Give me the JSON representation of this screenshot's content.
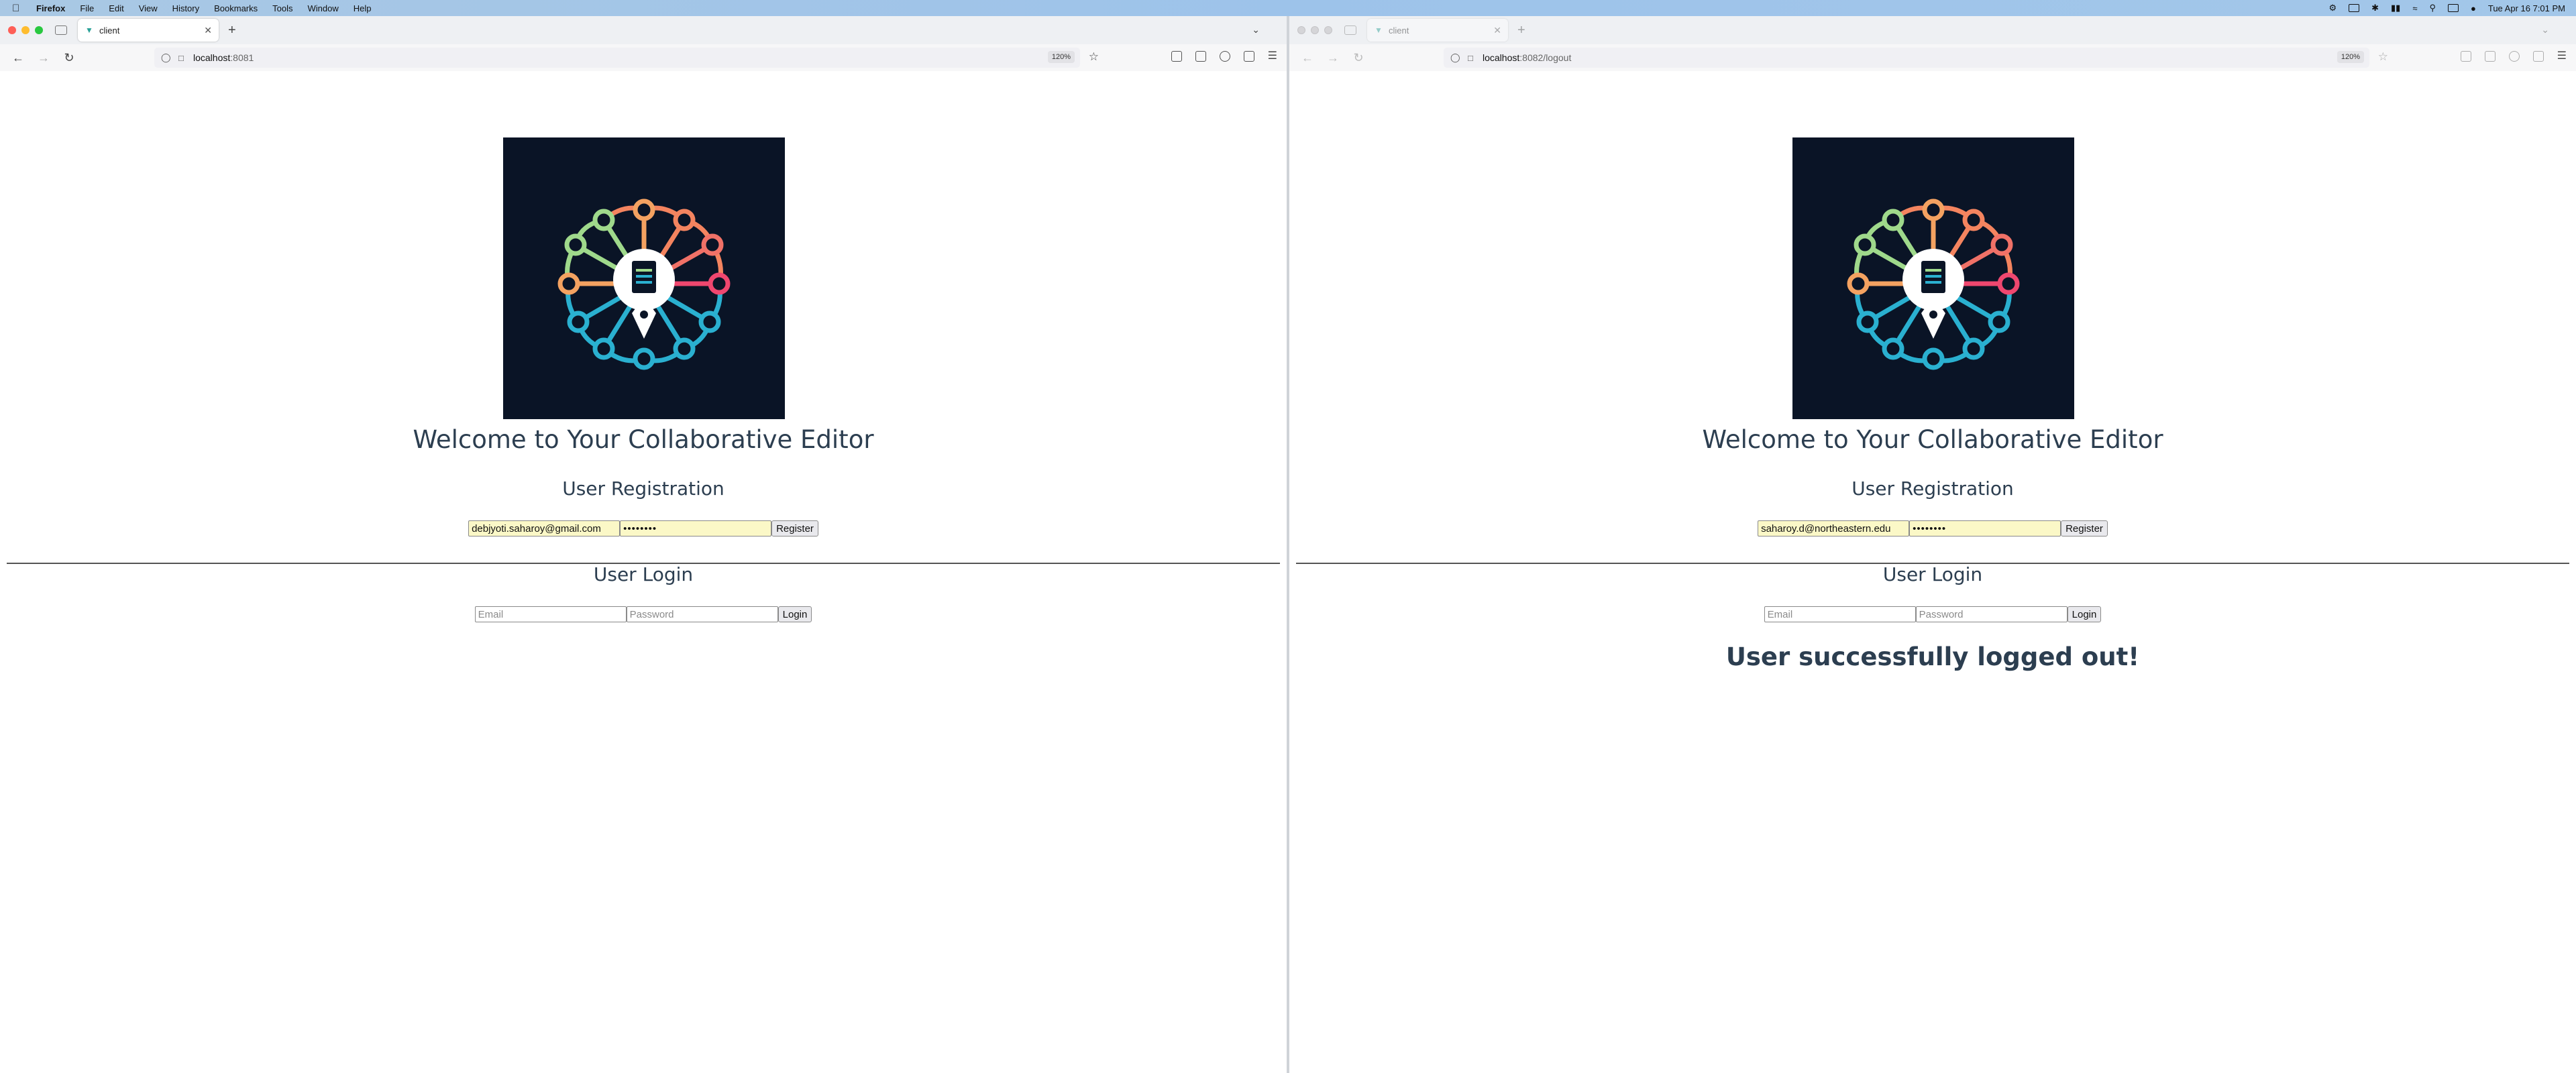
{
  "menubar": {
    "app": "Firefox",
    "items": [
      "File",
      "Edit",
      "View",
      "History",
      "Bookmarks",
      "Tools",
      "Window",
      "Help"
    ],
    "clock": "Tue Apr 16  7:01 PM"
  },
  "windows": [
    {
      "tab_title": "client",
      "url_host": "localhost",
      "url_path": ":8081",
      "zoom": "120%",
      "page": {
        "heading": "Welcome to Your Collaborative Editor",
        "registration_title": "User Registration",
        "reg_email_value": "debjyoti.saharoy@gmail.com",
        "reg_password_value": "••••••••",
        "register_label": "Register",
        "login_title": "User Login",
        "login_email_placeholder": "Email",
        "login_password_placeholder": "Password",
        "login_label": "Login",
        "status_message": ""
      }
    },
    {
      "tab_title": "client",
      "url_host": "localhost",
      "url_path": ":8082/logout",
      "zoom": "120%",
      "page": {
        "heading": "Welcome to Your Collaborative Editor",
        "registration_title": "User Registration",
        "reg_email_value": "saharoy.d@northeastern.edu",
        "reg_password_value": "••••••••",
        "register_label": "Register",
        "login_title": "User Login",
        "login_email_placeholder": "Email",
        "login_password_placeholder": "Password",
        "login_label": "Login",
        "status_message": "User successfully logged out!"
      }
    }
  ],
  "colors": {
    "heading": "#2c3e50",
    "logo_bg": "#0a1426",
    "autofill_bg": "#fbf8c7"
  }
}
